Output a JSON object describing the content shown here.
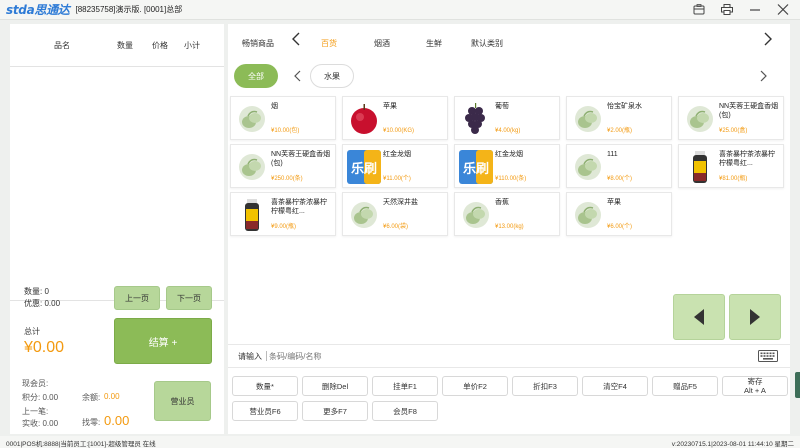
{
  "titlebar": {
    "logo": "stda思通达",
    "info": "[88235758]演示版. [0001]总部",
    "icons": [
      "wallet-icon",
      "printer-icon",
      "minimize-icon",
      "close-icon"
    ]
  },
  "cart": {
    "columns": [
      "品名",
      "数量",
      "价格",
      "小计"
    ],
    "quantity": "数量: 0",
    "discount": "优惠: 0.00",
    "prev_page": "上一页",
    "next_page": "下一页",
    "total_label": "总计",
    "total_amount": "¥0.00",
    "settle": "结算 +"
  },
  "member": {
    "current": "现会员:",
    "points": "积分: 0.00",
    "balance_label": "余额:",
    "balance": "0.00",
    "last": "上一笔:",
    "paid": "实收: 0.00",
    "change_label": "找零:",
    "change": "0.00",
    "clerk_button": "营业员"
  },
  "categories": {
    "items": [
      "畅销商品",
      "百货",
      "烟酒",
      "生鲜",
      "默认类别"
    ],
    "active": "百货",
    "sub_all": "全部",
    "sub_items": [
      "水果"
    ]
  },
  "products": [
    {
      "name": "烟",
      "price": "¥10.00(包)",
      "img": "placeholder"
    },
    {
      "name": "苹果",
      "price": "¥10.00(KG)",
      "img": "apple"
    },
    {
      "name": "葡萄",
      "price": "¥4.00(kg)",
      "img": "grape"
    },
    {
      "name": "怡宝矿泉水",
      "price": "¥2.00(瓶)",
      "img": "placeholder"
    },
    {
      "name": "NN芙蓉王硬盒香烟(包)",
      "price": "¥25.00(盒)",
      "img": "placeholder"
    },
    {
      "name": "NN芙蓉王硬盒香烟(包)",
      "price": "¥250.00(条)",
      "img": "placeholder"
    },
    {
      "name": "红金龙烟",
      "price": "¥11.00(个)",
      "img": "leshua"
    },
    {
      "name": "红金龙烟",
      "price": "¥110.00(条)",
      "img": "leshua"
    },
    {
      "name": "111",
      "price": "¥8.00(个)",
      "img": "placeholder"
    },
    {
      "name": "喜茶暴柠茶浓暴柠柠檬粤红...",
      "price": "¥81.00(瓶)",
      "img": "bottle"
    },
    {
      "name": "喜茶暴柠茶浓暴柠柠檬粤红...",
      "price": "¥9.00(瓶)",
      "img": "bottle"
    },
    {
      "name": "天然深井盐",
      "price": "¥6.00(袋)",
      "img": "placeholder"
    },
    {
      "name": "香蕉",
      "price": "¥13.00(kg)",
      "img": "placeholder"
    },
    {
      "name": "苹果",
      "price": "¥6.00(个)",
      "img": "placeholder"
    }
  ],
  "input": {
    "label": "请输入",
    "placeholder": "条码/编码/名称"
  },
  "functions": [
    {
      "label": "数量*",
      "sub": ""
    },
    {
      "label": "删除Del",
      "sub": ""
    },
    {
      "label": "挂单F1",
      "sub": ""
    },
    {
      "label": "单价F2",
      "sub": ""
    },
    {
      "label": "折扣F3",
      "sub": ""
    },
    {
      "label": "清空F4",
      "sub": ""
    },
    {
      "label": "赠品F5",
      "sub": ""
    },
    {
      "label": "寄存",
      "sub": "Alt + A"
    },
    {
      "label": "营业员F6",
      "sub": ""
    },
    {
      "label": "更多F7",
      "sub": ""
    },
    {
      "label": "会员F8",
      "sub": ""
    }
  ],
  "status": {
    "left": "0001|POS机:8888|当前员工:[1001]-超级管理员 在线",
    "right": "v:20230715.1|2023-08-01 11:44:10 星期二"
  },
  "colors": {
    "accent_orange": "#f39a10",
    "green": "#8cbb57",
    "light_green": "#c9e2b0",
    "logo_blue": "#2e7bd6"
  }
}
